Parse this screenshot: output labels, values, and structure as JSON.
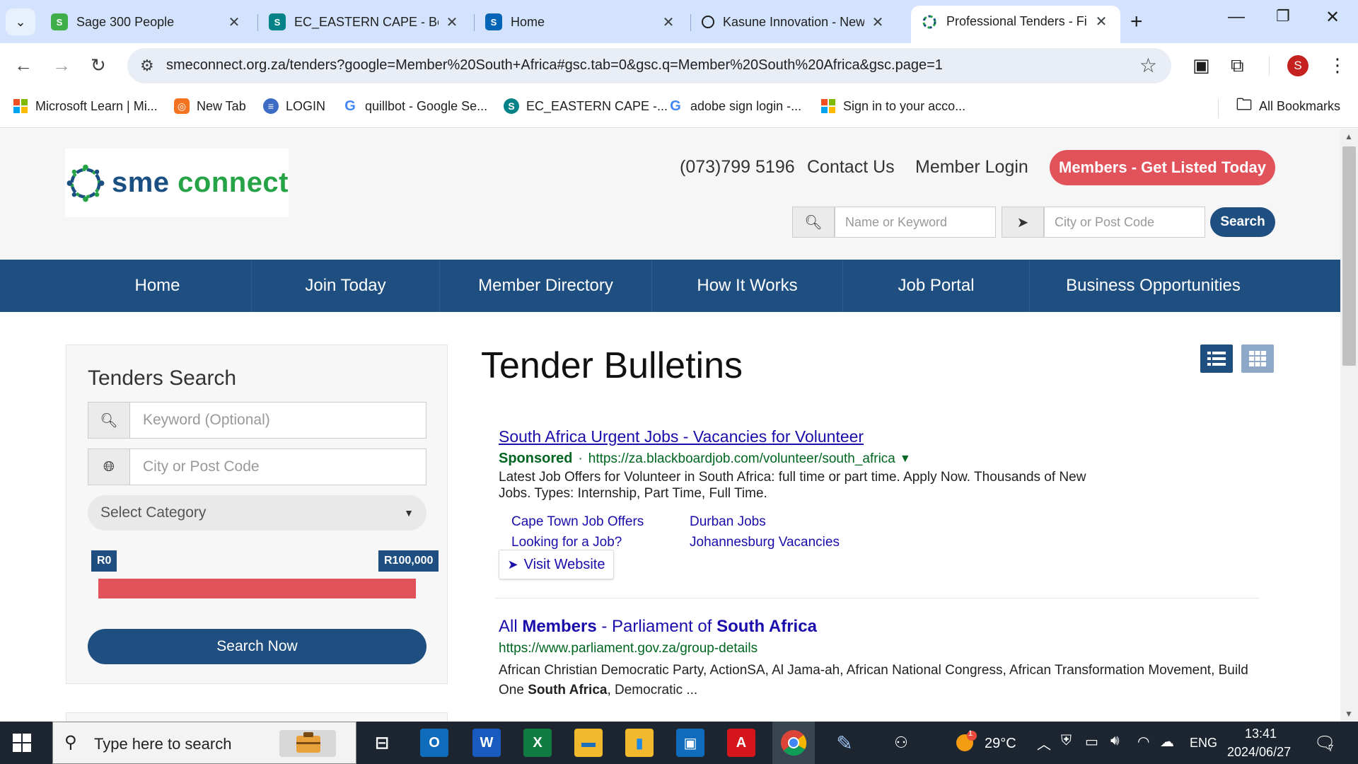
{
  "browser": {
    "tabs": [
      {
        "title": "Sage 300 People",
        "icon": "sage-icon",
        "color": "#3fae49",
        "active": false
      },
      {
        "title": "EC_EASTERN CAPE - Bene",
        "icon": "sharepoint-icon",
        "color": "#038387",
        "active": false
      },
      {
        "title": "Home",
        "icon": "sharepoint-icon",
        "color": "#0364b8",
        "active": false
      },
      {
        "title": "Kasune Innovation - New",
        "icon": "circle-icon",
        "color": "#1f1f1f",
        "active": false
      },
      {
        "title": "Professional Tenders - Fir",
        "icon": "smeconnect-icon",
        "color": "#1e4f80",
        "active": true
      }
    ],
    "tab_close": "✕",
    "new_tab": "+",
    "address": "smeconnect.org.za/tenders?google=Member%20South+Africa#gsc.tab=0&gsc.q=Member%20South%20Africa&gsc.page=1",
    "bookmarks": [
      {
        "label": "Microsoft Learn | Mi...",
        "icon": "microsoft-icon"
      },
      {
        "label": "New Tab",
        "icon": "newtab-icon"
      },
      {
        "label": "LOGIN",
        "icon": "login-icon"
      },
      {
        "label": "quillbot - Google Se...",
        "icon": "google-icon"
      },
      {
        "label": "EC_EASTERN CAPE -...",
        "icon": "sharepoint-icon"
      },
      {
        "label": "adobe sign login -...",
        "icon": "google-icon"
      },
      {
        "label": "Sign in to your acco...",
        "icon": "microsoft-icon"
      }
    ],
    "all_bookmarks": "All Bookmarks",
    "profile_initial": "S"
  },
  "site": {
    "logo_sme": "sme",
    "logo_connect": "connect",
    "phone": "(073)799 5196",
    "contact": "Contact Us",
    "login": "Member Login",
    "cta": "Members - Get Listed Today",
    "search_keyword_placeholder": "Name or Keyword",
    "search_city_placeholder": "City or Post Code",
    "search_button": "Search",
    "nav": [
      "Home",
      "Join Today",
      "Member Directory",
      "How It Works",
      "Job Portal",
      "Business Opportunities"
    ]
  },
  "sidebar": {
    "title": "Tenders Search",
    "keyword_placeholder": "Keyword (Optional)",
    "city_placeholder": "City or Post Code",
    "category": "Select Category",
    "range_min": "R0",
    "range_max": "R100,000",
    "range_fill_fraction": 1.0,
    "button": "Search Now"
  },
  "main": {
    "title": "Tender Bulletins",
    "ad": {
      "title": "South Africa Urgent Jobs - Vacancies for Volunteer",
      "sponsored": "Sponsored",
      "dot": "·",
      "url": "https://za.blackboardjob.com/volunteer/south_africa",
      "caret": "▼",
      "description": "Latest Job Offers for Volunteer in South Africa: full time or part time. Apply Now. Thousands of New Jobs. Types: Internship, Part Time, Full Time.",
      "sitelinks": [
        "Cape Town Job Offers",
        "Durban Jobs",
        "Looking for a Job?",
        "Johannesburg Vacancies"
      ],
      "visit_arrow": "➤",
      "visit": "Visit Website"
    },
    "result": {
      "title_parts": [
        "All ",
        "Members",
        " - Parliament of ",
        "South Africa"
      ],
      "url": "https://www.parliament.gov.za/group-details",
      "snippet_start": "African Christian Democratic Party, ActionSA, Al Jama-ah, African National Congress, African Transformation Movement, Build One ",
      "snippet_bold": "South Africa",
      "snippet_end": ", Democratic ..."
    }
  },
  "taskbar": {
    "search_text": "Type here to search",
    "apps": [
      {
        "name": "outlook",
        "label": "O",
        "color": "#0f6cbd"
      },
      {
        "name": "word",
        "label": "W",
        "color": "#185abd"
      },
      {
        "name": "excel",
        "label": "X",
        "color": "#107c41"
      },
      {
        "name": "file-explorer",
        "label": "▬",
        "color": "#f2b92f"
      },
      {
        "name": "files",
        "label": "▮",
        "color": "#1e88e5"
      },
      {
        "name": "defender",
        "label": "▣",
        "color": "#0f6cbd"
      },
      {
        "name": "acrobat",
        "label": "A",
        "color": "#d4151b"
      },
      {
        "name": "chrome",
        "label": "◉",
        "color": "#4285f4"
      },
      {
        "name": "paint",
        "label": "✎",
        "color": "#5b7aa8"
      }
    ],
    "weather_temp": "29°C",
    "weather_badge": "1",
    "language": "ENG",
    "time": "13:41",
    "date": "2024/06/27",
    "notifications": "7"
  },
  "colors": {
    "brand_blue": "#1e4f80",
    "accent_red": "#e2525b",
    "logo_green": "#27a347"
  }
}
